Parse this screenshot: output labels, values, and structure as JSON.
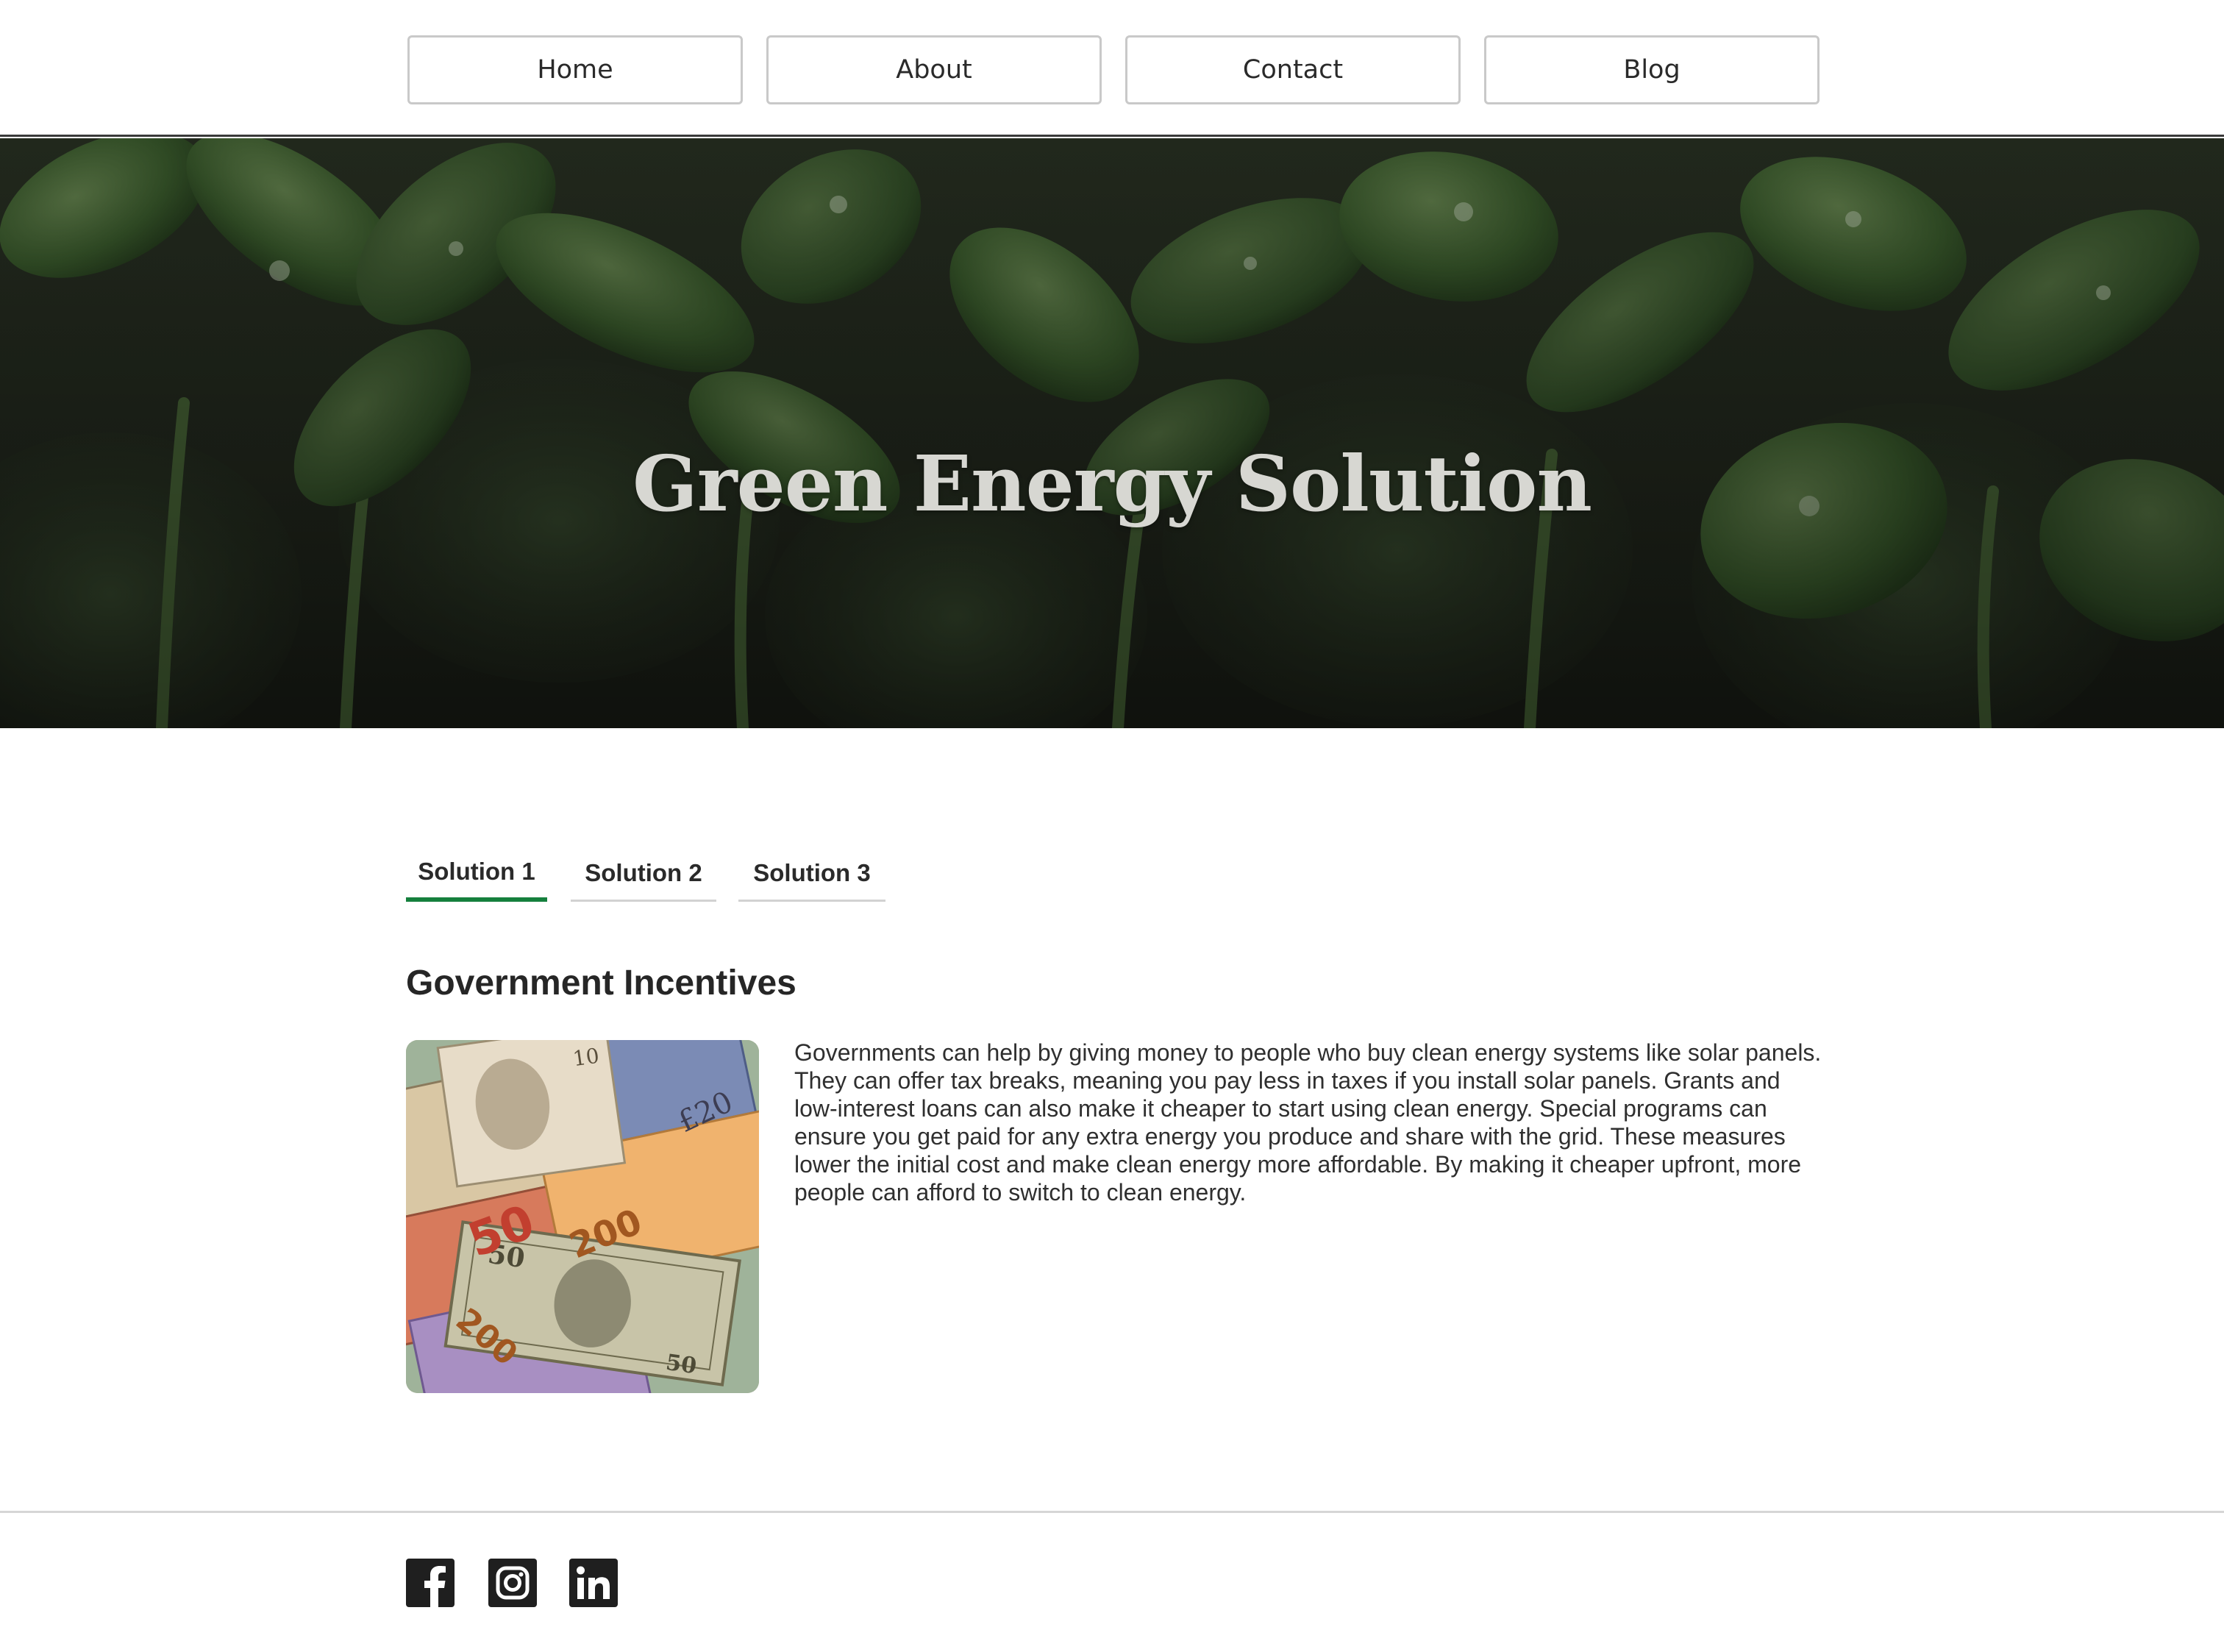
{
  "nav": {
    "items": [
      {
        "label": "Home"
      },
      {
        "label": "About"
      },
      {
        "label": "Contact"
      },
      {
        "label": "Blog"
      }
    ]
  },
  "hero": {
    "title": "Green Energy Solution",
    "image": "seedlings-with-water-droplets"
  },
  "tabs": [
    {
      "label": "Solution 1",
      "active": true
    },
    {
      "label": "Solution 2",
      "active": false
    },
    {
      "label": "Solution 3",
      "active": false
    }
  ],
  "content": {
    "heading": "Government Incentives",
    "image": "assorted-banknotes",
    "body": "Governments can help by giving money to people who buy clean energy systems like solar panels. They can offer tax breaks, meaning you pay less in taxes if you install solar panels. Grants and low-interest loans can also make it cheaper to start using clean energy. Special programs can ensure you get paid for any extra energy you produce and share with the grid. These measures lower the initial cost and make clean energy more affordable. By making it cheaper upfront, more people can afford to switch to clean energy."
  },
  "footer": {
    "social": [
      {
        "icon": "facebook-icon"
      },
      {
        "icon": "instagram-icon"
      },
      {
        "icon": "linkedin-icon"
      }
    ]
  },
  "colors": {
    "accent": "#15803d",
    "text": "#2b2b2b",
    "hero_overlay": "#1f2a1c"
  }
}
